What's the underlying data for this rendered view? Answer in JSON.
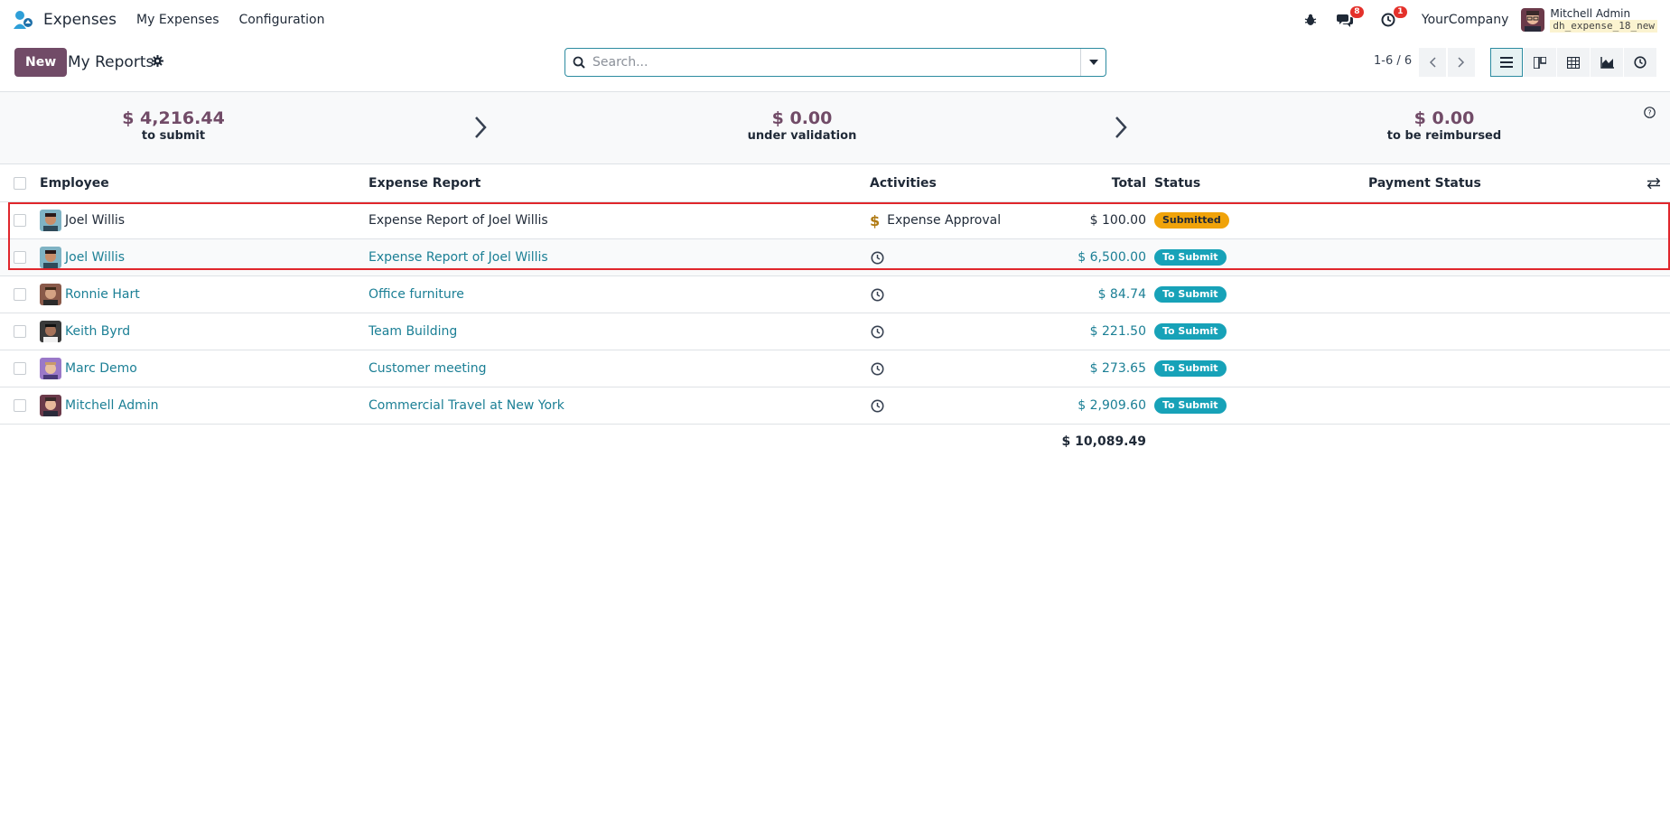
{
  "navbar": {
    "app_name": "Expenses",
    "menus": [
      "My Expenses",
      "Configuration"
    ],
    "messages_count": "8",
    "activities_count": "1",
    "company": "YourCompany",
    "user_name": "Mitchell Admin",
    "db_name": "dh_expense_18_new"
  },
  "control_panel": {
    "new_label": "New",
    "title": "My Reports",
    "search_placeholder": "Search...",
    "pager": "1-6 / 6"
  },
  "summary": {
    "to_submit_amount": "$ 4,216.44",
    "to_submit_label": "to submit",
    "under_validation_amount": "$ 0.00",
    "under_validation_label": "under validation",
    "to_be_reimbursed_amount": "$ 0.00",
    "to_be_reimbursed_label": "to be reimbursed"
  },
  "table": {
    "headers": {
      "employee": "Employee",
      "expense_report": "Expense Report",
      "activities": "Activities",
      "total": "Total",
      "status": "Status",
      "payment_status": "Payment Status"
    },
    "rows": [
      {
        "employee": "Joel Willis",
        "report": "Expense Report of Joel Willis",
        "activity": "Expense Approval",
        "total": "$ 100.00",
        "status": "Submitted"
      },
      {
        "employee": "Joel Willis",
        "report": "Expense Report of Joel Willis",
        "activity": "",
        "total": "$ 6,500.00",
        "status": "To Submit"
      },
      {
        "employee": "Ronnie Hart",
        "report": "Office furniture",
        "activity": "",
        "total": "$ 84.74",
        "status": "To Submit"
      },
      {
        "employee": "Keith Byrd",
        "report": "Team Building",
        "activity": "",
        "total": "$ 221.50",
        "status": "To Submit"
      },
      {
        "employee": "Marc Demo",
        "report": "Customer meeting",
        "activity": "",
        "total": "$ 273.65",
        "status": "To Submit"
      },
      {
        "employee": "Mitchell Admin",
        "report": "Commercial Travel at New York",
        "activity": "",
        "total": "$ 2,909.60",
        "status": "To Submit"
      }
    ],
    "grand_total": "$ 10,089.49"
  },
  "colors": {
    "brand": "#714b67",
    "link": "#1b7f95",
    "status_submitted": "#f0a30a",
    "status_to_submit": "#17a2b8",
    "highlight": "#e0262c"
  },
  "icons": [
    "expenses-logo-icon",
    "bug-icon",
    "chat-icon",
    "clock-icon",
    "gear-icon",
    "search-icon",
    "caret-down-icon",
    "chevron-left-icon",
    "chevron-right-icon",
    "list-view-icon",
    "kanban-view-icon",
    "pivot-view-icon",
    "graph-view-icon",
    "activity-view-icon",
    "help-icon",
    "dollar-icon",
    "optional-columns-icon"
  ]
}
